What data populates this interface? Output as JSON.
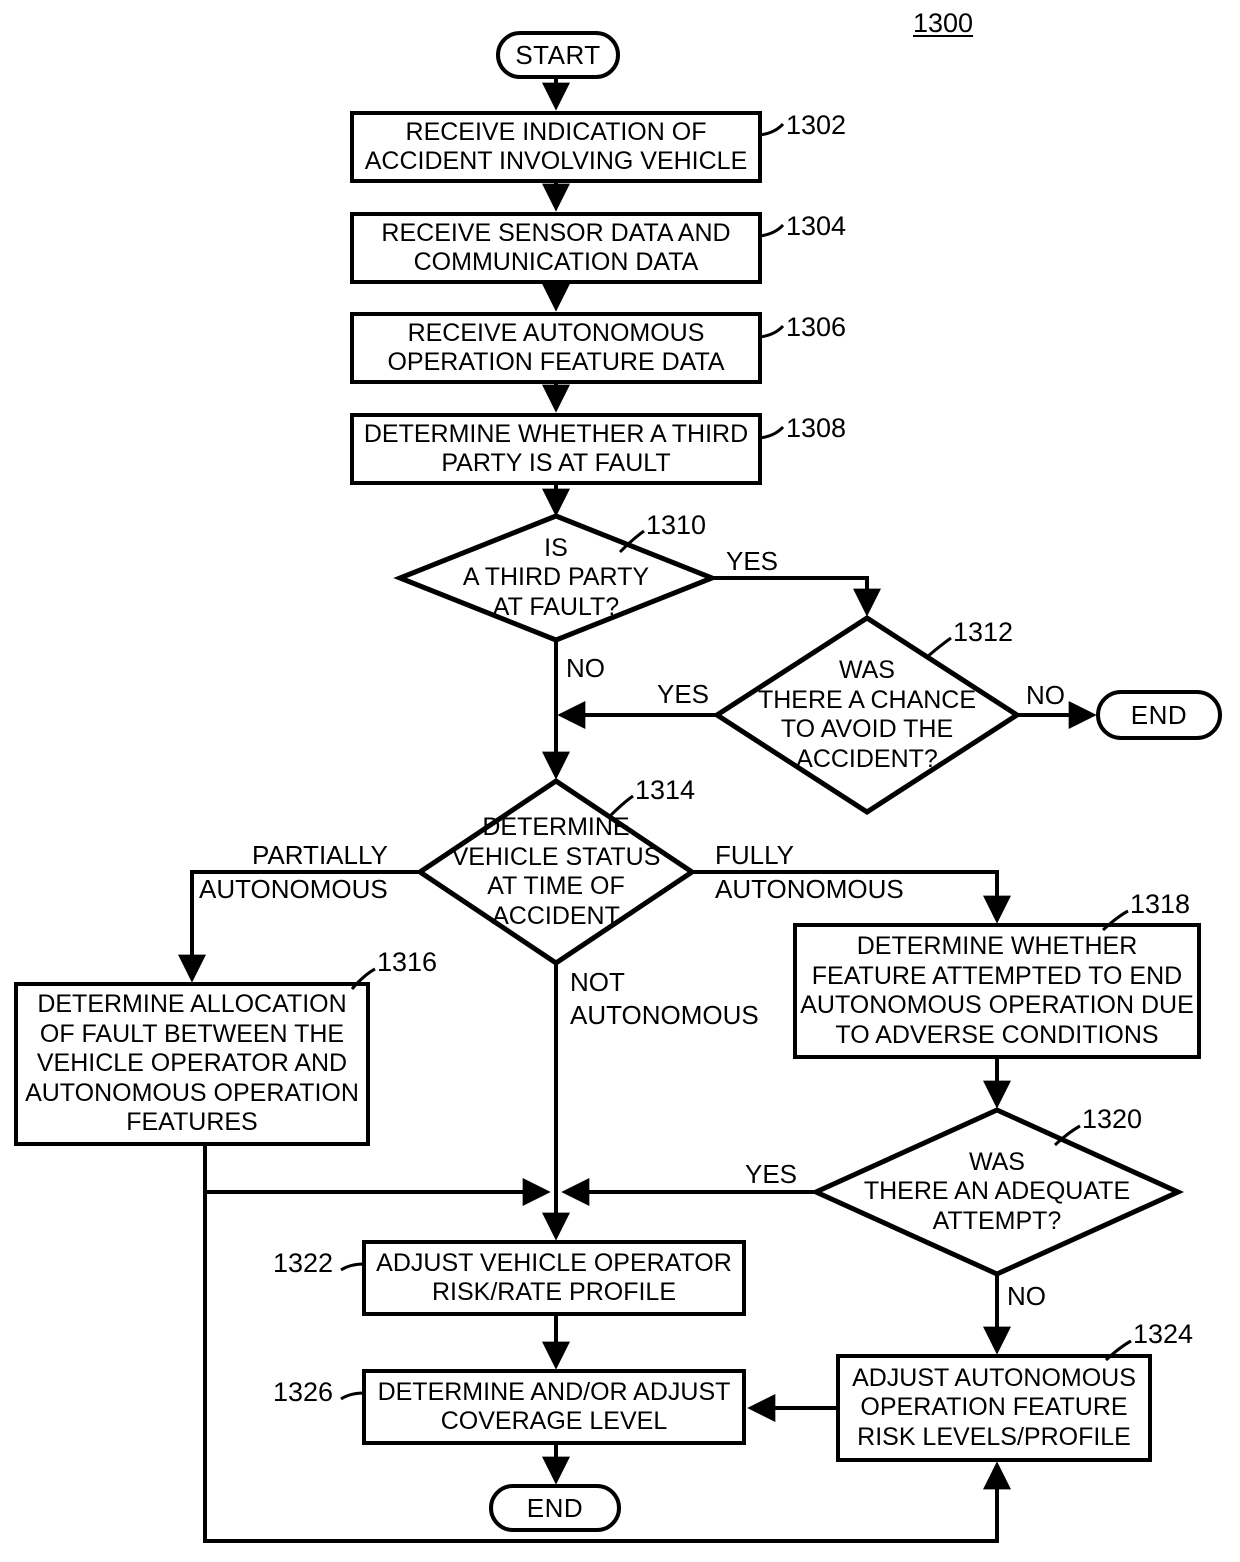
{
  "figure": {
    "number": "1300"
  },
  "terminals": {
    "start": "START",
    "end_right": "END",
    "end_bottom": "END"
  },
  "process_boxes": [
    {
      "id": "1302",
      "text": "RECEIVE INDICATION OF\nACCIDENT INVOLVING VEHICLE"
    },
    {
      "id": "1304",
      "text": "RECEIVE SENSOR DATA AND\nCOMMUNICATION DATA"
    },
    {
      "id": "1306",
      "text": "RECEIVE AUTONOMOUS\nOPERATION FEATURE DATA"
    },
    {
      "id": "1308",
      "text": "DETERMINE WHETHER A THIRD\nPARTY IS AT FAULT"
    },
    {
      "id": "1316",
      "text": "DETERMINE ALLOCATION\nOF FAULT BETWEEN THE\nVEHICLE OPERATOR AND\nAUTONOMOUS OPERATION\nFEATURES"
    },
    {
      "id": "1318",
      "text": "DETERMINE WHETHER\nFEATURE ATTEMPTED TO END\nAUTONOMOUS OPERATION DUE\nTO ADVERSE CONDITIONS"
    },
    {
      "id": "1322",
      "text": "ADJUST VEHICLE OPERATOR\nRISK/RATE PROFILE"
    },
    {
      "id": "1324",
      "text": "ADJUST AUTONOMOUS\nOPERATION FEATURE\nRISK LEVELS/PROFILE"
    },
    {
      "id": "1326",
      "text": "DETERMINE AND/OR ADJUST\nCOVERAGE LEVEL"
    }
  ],
  "decisions": [
    {
      "id": "1310",
      "text": "IS\nA THIRD PARTY\nAT FAULT?"
    },
    {
      "id": "1312",
      "text": "WAS\nTHERE A CHANCE\nTO AVOID THE\nACCIDENT?"
    },
    {
      "id": "1314",
      "text": "DETERMINE\nVEHICLE  STATUS\nAT TIME OF\nACCIDENT"
    },
    {
      "id": "1320",
      "text": "WAS\nTHERE AN ADEQUATE\nATTEMPT?"
    }
  ],
  "edge_labels": {
    "d1310_yes": "YES",
    "d1310_no": "NO",
    "d1312_yes": "YES",
    "d1312_no": "NO",
    "d1314_partially": "PARTIALLY\nAUTONOMOUS",
    "d1314_partially_l1": "PARTIALLY",
    "d1314_partially_l2": "AUTONOMOUS",
    "d1314_fully_l1": "FULLY",
    "d1314_fully_l2": "AUTONOMOUS",
    "d1314_not_l1": "NOT",
    "d1314_not_l2": "AUTONOMOUS",
    "d1320_yes": "YES",
    "d1320_no": "NO"
  },
  "ref_numbers": {
    "n1302": "1302",
    "n1304": "1304",
    "n1306": "1306",
    "n1308": "1308",
    "n1310": "1310",
    "n1312": "1312",
    "n1314": "1314",
    "n1316": "1316",
    "n1318": "1318",
    "n1320": "1320",
    "n1322": "1322",
    "n1324": "1324",
    "n1326": "1326"
  },
  "colors": {
    "stroke": "#000000",
    "fill": "#ffffff",
    "text": "#000000"
  }
}
